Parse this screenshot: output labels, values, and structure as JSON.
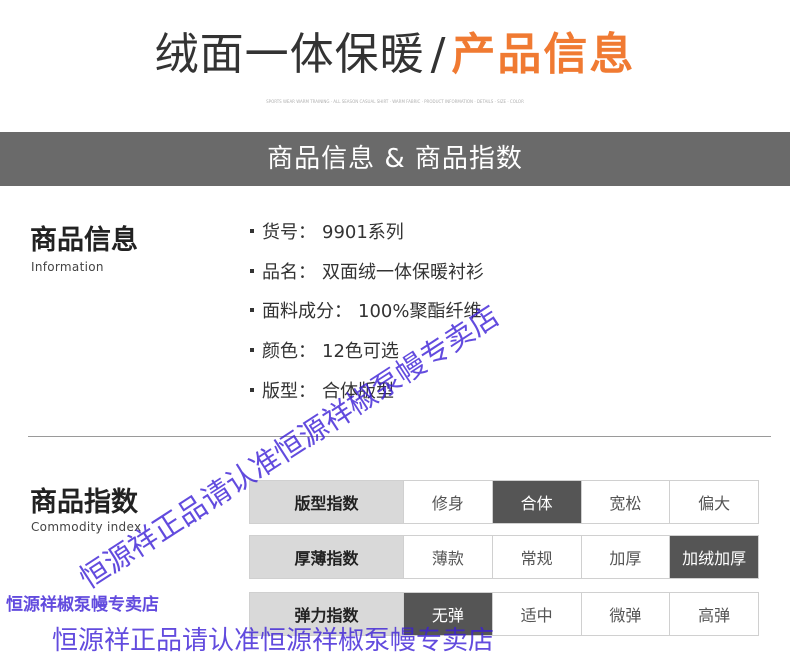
{
  "header": {
    "title_main": "绒面一体保暖",
    "title_slash": "/",
    "title_accent": "产品信息",
    "tiny_text": "SPORTS WEAR WARM TRAINING · ALL SEASON CASUAL SHIRT · WARM FABRIC · PRODUCT INFORMATION · DETAILS · SIZE · COLOR"
  },
  "banner": {
    "title": "商品信息 & 商品指数"
  },
  "info_section": {
    "title": "商品信息",
    "subtitle": "Information",
    "items": [
      {
        "label": "货号：",
        "value": "9901系列"
      },
      {
        "label": "品名：",
        "value": "双面绒一体保暖衬衫"
      },
      {
        "label": "面料成分：",
        "value": "100%聚酯纤维"
      },
      {
        "label": "颜色：",
        "value": "12色可选"
      },
      {
        "label": "版型：",
        "value": "合体版型"
      }
    ]
  },
  "index_section": {
    "title": "商品指数",
    "subtitle": "Commodity index",
    "rows": [
      {
        "label": "版型指数",
        "options": [
          "修身",
          "合体",
          "宽松",
          "偏大"
        ],
        "selected": 1
      },
      {
        "label": "厚薄指数",
        "options": [
          "薄款",
          "常规",
          "加厚",
          "加绒加厚"
        ],
        "selected": 3
      },
      {
        "label": "弹力指数",
        "options": [
          "无弹",
          "适中",
          "微弹",
          "高弹"
        ],
        "selected": 0
      }
    ]
  },
  "watermarks": {
    "diagonal": "恒源祥正品请认准恒源祥椒泵幔专卖店",
    "left_small": "恒源祥椒泵幔专卖店",
    "bottom": "恒源祥正品请认准恒源祥椒泵幔专卖店"
  },
  "colors": {
    "accent": "#f07a32",
    "banner_bg": "#6a6a6a",
    "header_cell": "#d9d9d9",
    "selected_cell": "#555555",
    "watermark": "#3b1fd6"
  }
}
